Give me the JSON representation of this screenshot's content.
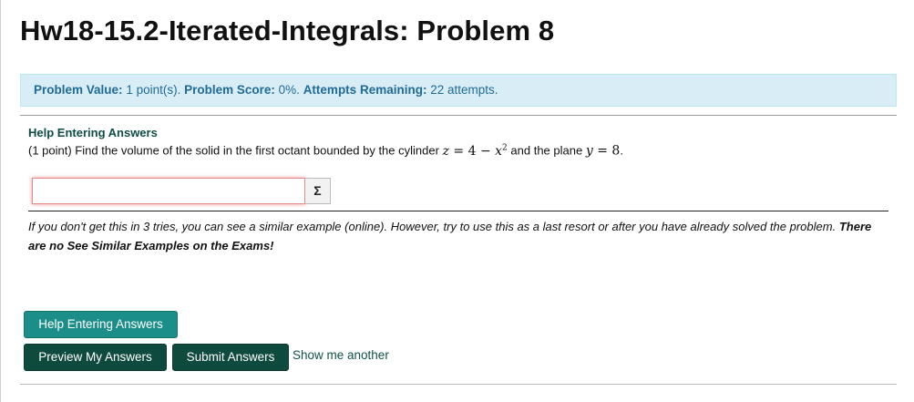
{
  "page": {
    "title": "Hw18-15.2-Iterated-Integrals: Problem 8"
  },
  "info_bar": {
    "value_label": "Problem Value:",
    "value_text": "1 point(s).",
    "score_label": "Problem Score:",
    "score_text": "0%.",
    "attempts_label": "Attempts Remaining:",
    "attempts_text": "22 attempts."
  },
  "problem": {
    "help_link": "Help Entering Answers",
    "prefix": "(1 point) Find the volume of the solid in the first octant bounded by the cylinder",
    "math1_var": "z",
    "math1_rel": "=",
    "math1_expr": "4 −",
    "math1_x": "x",
    "math1_exp": "2",
    "connector": "and the plane",
    "math2_var": "y",
    "math2_rel": "=",
    "math2_val": "8",
    "suffix": "."
  },
  "answer": {
    "value": "",
    "placeholder": "",
    "equation_button": "Σ"
  },
  "note": {
    "text": "If you don't get this in 3 tries, you can see a similar example (online). However, try to use this as a last resort or after you have already solved the problem.",
    "bold_text": "There are no See Similar Examples on the Exams!"
  },
  "buttons": {
    "help": "Help Entering Answers",
    "preview": "Preview My Answers",
    "submit": "Submit Answers",
    "show_another": "Show me another"
  },
  "colors": {
    "info_bg": "#d9edf7",
    "info_text": "#1f6b96",
    "help_button": "#1b8e8a",
    "primary_button": "#0f4a3f",
    "input_error": "#e28b8b"
  }
}
